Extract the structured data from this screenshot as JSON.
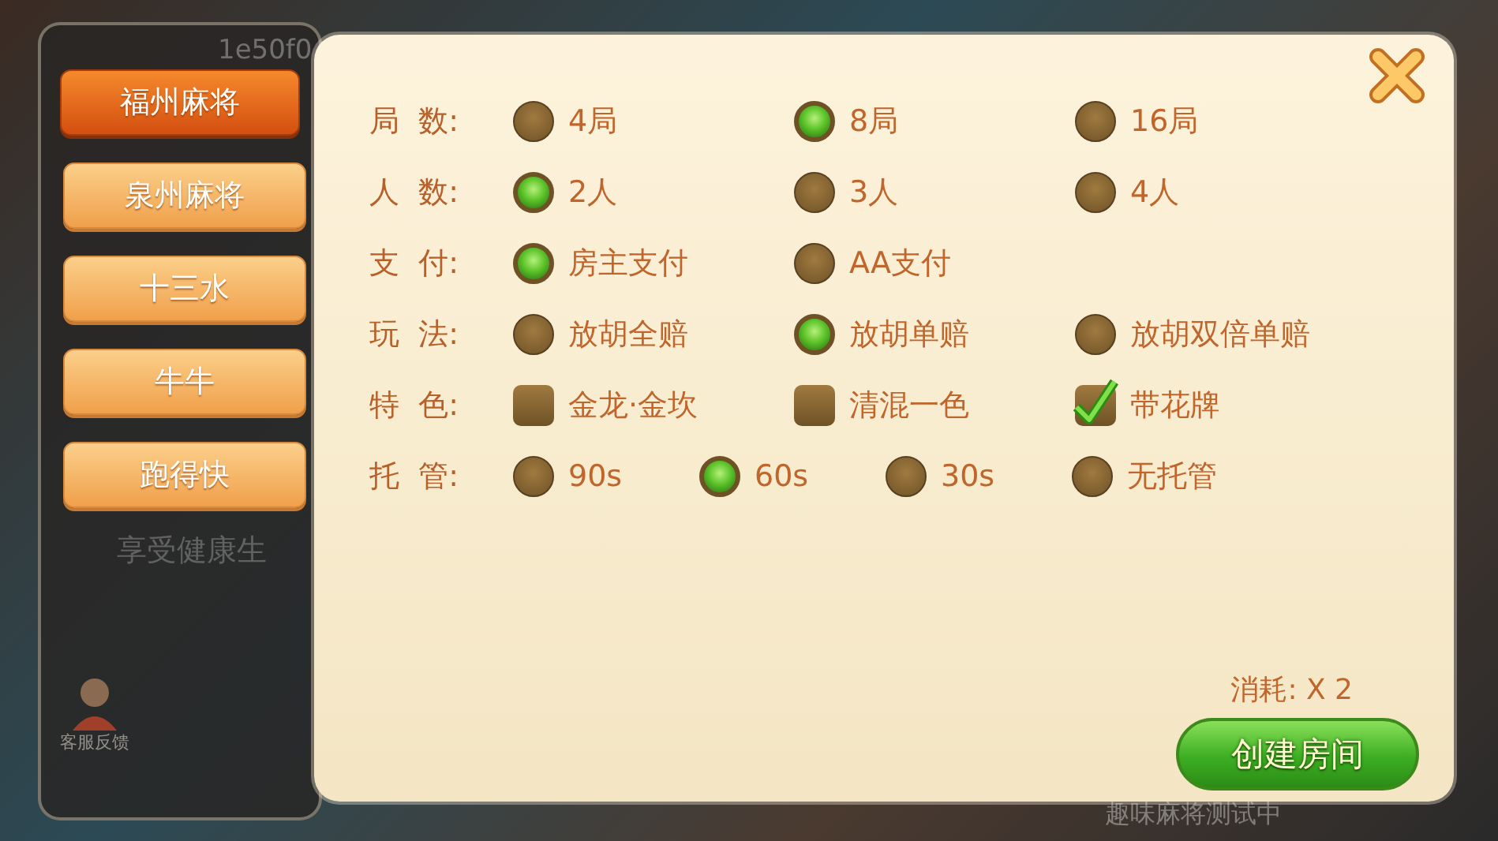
{
  "background": {
    "user_id": "1e50f0",
    "notice": "享受健康生",
    "avatar_label": "客服反馈",
    "footer_text": "趣味麻将测试中"
  },
  "game_tabs": [
    {
      "label": "福州麻将",
      "selected": true
    },
    {
      "label": "泉州麻将",
      "selected": false
    },
    {
      "label": "十三水",
      "selected": false
    },
    {
      "label": "牛牛",
      "selected": false
    },
    {
      "label": "跑得快",
      "selected": false
    }
  ],
  "settings": [
    {
      "label": "局  数:",
      "kind": "radio",
      "options": [
        {
          "label": "4局",
          "selected": false
        },
        {
          "label": "8局",
          "selected": true
        },
        {
          "label": "16局",
          "selected": false
        }
      ]
    },
    {
      "label": "人  数:",
      "kind": "radio",
      "options": [
        {
          "label": "2人",
          "selected": true
        },
        {
          "label": "3人",
          "selected": false
        },
        {
          "label": "4人",
          "selected": false
        }
      ]
    },
    {
      "label": "支  付:",
      "kind": "radio",
      "options": [
        {
          "label": "房主支付",
          "selected": true
        },
        {
          "label": "AA支付",
          "selected": false
        }
      ]
    },
    {
      "label": "玩  法:",
      "kind": "radio",
      "options": [
        {
          "label": "放胡全赔",
          "selected": false
        },
        {
          "label": "放胡单赔",
          "selected": true
        },
        {
          "label": "放胡双倍单赔",
          "selected": false
        }
      ]
    },
    {
      "label": "特  色:",
      "kind": "checkbox",
      "options": [
        {
          "label": "金龙·金坎",
          "checked": false
        },
        {
          "label": "清混一色",
          "checked": false
        },
        {
          "label": "带花牌",
          "checked": true
        }
      ]
    },
    {
      "label": "托  管:",
      "kind": "radio",
      "options": [
        {
          "label": "90s",
          "selected": false
        },
        {
          "label": "60s",
          "selected": true
        },
        {
          "label": "30s",
          "selected": false
        },
        {
          "label": "无托管",
          "selected": false
        }
      ]
    }
  ],
  "cost": "消耗: X 2",
  "create_button": "创建房间"
}
